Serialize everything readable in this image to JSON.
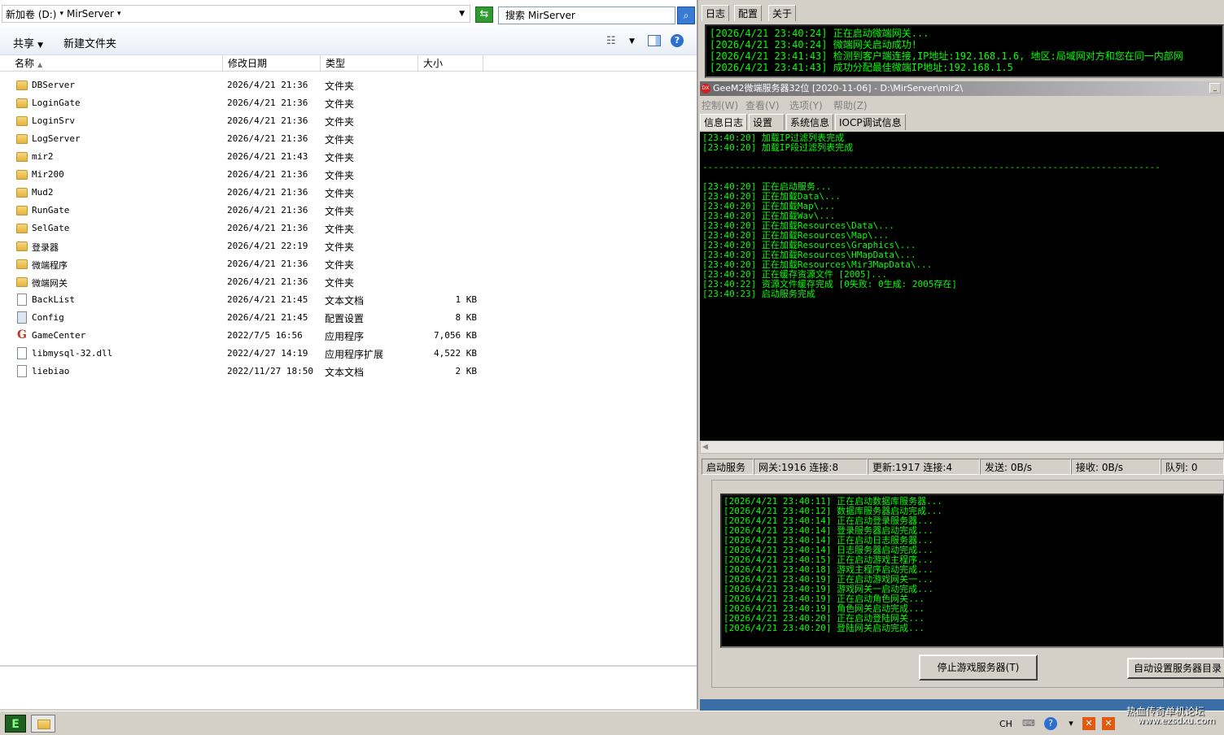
{
  "explorer": {
    "breadcrumb": [
      "新加卷 (D:)",
      "MirServer"
    ],
    "search_placeholder": "搜索 MirServer",
    "toolbar": {
      "share": "共享",
      "new_folder": "新建文件夹"
    },
    "columns": {
      "name": "名称",
      "date": "修改日期",
      "type": "类型",
      "size": "大小"
    },
    "files": [
      {
        "name": "DBServer",
        "date": "2026/4/21 21:36",
        "type": "文件夹",
        "size": "",
        "icon": "folder"
      },
      {
        "name": "LoginGate",
        "date": "2026/4/21 21:36",
        "type": "文件夹",
        "size": "",
        "icon": "folder"
      },
      {
        "name": "LoginSrv",
        "date": "2026/4/21 21:36",
        "type": "文件夹",
        "size": "",
        "icon": "folder"
      },
      {
        "name": "LogServer",
        "date": "2026/4/21 21:36",
        "type": "文件夹",
        "size": "",
        "icon": "folder"
      },
      {
        "name": "mir2",
        "date": "2026/4/21 21:43",
        "type": "文件夹",
        "size": "",
        "icon": "folder"
      },
      {
        "name": "Mir200",
        "date": "2026/4/21 21:36",
        "type": "文件夹",
        "size": "",
        "icon": "folder"
      },
      {
        "name": "Mud2",
        "date": "2026/4/21 21:36",
        "type": "文件夹",
        "size": "",
        "icon": "folder"
      },
      {
        "name": "RunGate",
        "date": "2026/4/21 21:36",
        "type": "文件夹",
        "size": "",
        "icon": "folder"
      },
      {
        "name": "SelGate",
        "date": "2026/4/21 21:36",
        "type": "文件夹",
        "size": "",
        "icon": "folder"
      },
      {
        "name": "登录器",
        "date": "2026/4/21 22:19",
        "type": "文件夹",
        "size": "",
        "icon": "folder"
      },
      {
        "name": "微端程序",
        "date": "2026/4/21 21:36",
        "type": "文件夹",
        "size": "",
        "icon": "folder"
      },
      {
        "name": "微端网关",
        "date": "2026/4/21 21:36",
        "type": "文件夹",
        "size": "",
        "icon": "folder"
      },
      {
        "name": "BackList",
        "date": "2026/4/21 21:45",
        "type": "文本文档",
        "size": "1 KB",
        "icon": "file"
      },
      {
        "name": "Config",
        "date": "2026/4/21 21:45",
        "type": "配置设置",
        "size": "8 KB",
        "icon": "cfg"
      },
      {
        "name": "GameCenter",
        "date": "2022/7/5 16:56",
        "type": "应用程序",
        "size": "7,056 KB",
        "icon": "app"
      },
      {
        "name": "libmysql-32.dll",
        "date": "2022/4/27 14:19",
        "type": "应用程序扩展",
        "size": "4,522 KB",
        "icon": "dll"
      },
      {
        "name": "liebiao",
        "date": "2022/11/27 18:50",
        "type": "文本文档",
        "size": "2 KB",
        "icon": "file"
      }
    ]
  },
  "gate": {
    "tabs": [
      "日志",
      "配置",
      "关于"
    ],
    "log": [
      "[2026/4/21 23:40:24] 正在启动微端网关...",
      "[2026/4/21 23:40:24] 微端网关启动成功!",
      "[2026/4/21 23:41:43] 检测到客户端连接,IP地址:192.168.1.6, 地区:局域网对方和您在同一内部网",
      "[2026/4/21 23:41:43] 成功分配最佳微端IP地址:192.168.1.5"
    ]
  },
  "m2": {
    "title": "GeeM2微端服务器32位 [2020-11-06] - D:\\MirServer\\mir2\\",
    "logo": "DX",
    "menu": [
      "控制(W)",
      "查看(V)",
      "选项(Y)",
      "帮助(Z)"
    ],
    "tabs": [
      "信息日志",
      "设置",
      "系统信息",
      "IOCP调试信息"
    ],
    "log": [
      "[23:40:20] 加载IP过滤列表完成",
      "[23:40:20] 加载IP段过滤列表完成",
      "",
      "-------------------------------------------------------------------------------------",
      "",
      "[23:40:20] 正在启动服务...",
      "[23:40:20] 正在加载Data\\...",
      "[23:40:20] 正在加载Map\\...",
      "[23:40:20] 正在加载Wav\\...",
      "[23:40:20] 正在加载Resources\\Data\\...",
      "[23:40:20] 正在加载Resources\\Map\\...",
      "[23:40:20] 正在加载Resources\\Graphics\\...",
      "[23:40:20] 正在加载Resources\\HMapData\\...",
      "[23:40:20] 正在加载Resources\\Mir3MapData\\...",
      "[23:40:20] 正在缓存资源文件 [2005]...",
      "[23:40:22] 资源文件缓存完成 [0失败: 0生成: 2005存在]",
      "[23:40:23] 启动服务完成"
    ],
    "status": {
      "start": "启动服务",
      "gateway": "网关:1916  连接:8",
      "update": "更新:1917  连接:4",
      "send": "发送: 0B/s",
      "recv": "接收: 0B/s",
      "queue": "队列: 0"
    },
    "log2": [
      "[2026/4/21 23:40:11] 正在启动数据库服务器...",
      "[2026/4/21 23:40:12] 数据库服务器启动完成...",
      "[2026/4/21 23:40:14] 正在启动登录服务器...",
      "[2026/4/21 23:40:14] 登录服务器启动完成...",
      "[2026/4/21 23:40:14] 正在启动日志服务器...",
      "[2026/4/21 23:40:14] 日志服务器启动完成...",
      "[2026/4/21 23:40:15] 正在启动游戏主程序...",
      "[2026/4/21 23:40:18] 游戏主程序启动完成...",
      "[2026/4/21 23:40:19] 正在启动游戏网关一...",
      "[2026/4/21 23:40:19] 游戏网关一启动完成...",
      "[2026/4/21 23:40:19] 正在启动角色网关...",
      "[2026/4/21 23:40:19] 角色网关启动完成...",
      "[2026/4/21 23:40:20] 正在启动登陆网关...",
      "[2026/4/21 23:40:20] 登陆网关启动完成..."
    ],
    "buttons": {
      "stop": "停止游戏服务器(T)",
      "auto_dir": "自动设置服务器目录"
    }
  },
  "taskbar": {
    "lang": "CH",
    "watermark": "热血传奇单机论坛",
    "watermark_sub": "www.ezsdxu.com"
  }
}
